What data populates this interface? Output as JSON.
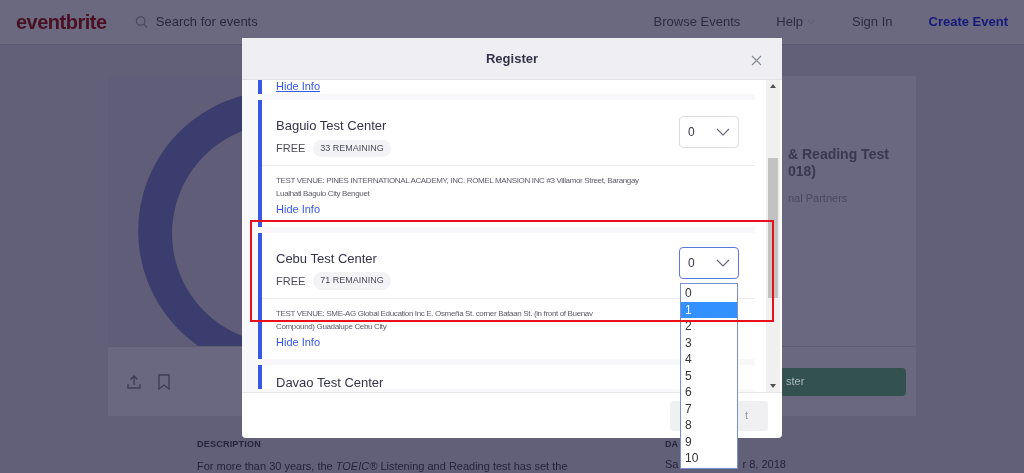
{
  "header": {
    "logo": "eventbrite",
    "search_placeholder": "Search for events",
    "nav": [
      {
        "label": "Browse Events",
        "kind": "link"
      },
      {
        "label": "Help",
        "kind": "menu"
      },
      {
        "label": "Sign In",
        "kind": "link"
      },
      {
        "label": "Create Event",
        "kind": "primary"
      }
    ]
  },
  "event": {
    "title_lines": [
      "& Reading Test",
      "018)"
    ],
    "organizer": "nal Partners",
    "register_button": "ster",
    "description_heading": "DESCRIPTION",
    "description": "For more than 30 years, the *TOEIC®* Listening and Reading test has set the",
    "date_heading": "DA",
    "date_parts": [
      "Sa",
      "r 8, 2018"
    ]
  },
  "modal": {
    "title": "Register",
    "tickets": [
      {
        "kind": "tail",
        "link": "Hide Info"
      },
      {
        "kind": "full",
        "name": "Baguio Test Center",
        "price": "FREE",
        "remaining": "33 REMAINING",
        "quantity": "0",
        "focused": false,
        "venue_lines": [
          "TEST VENUE: PINES INTERNATIONAL ACADEMY, INC. ROMEL MANSION INC #3 Villamor Street, Barangay",
          "Lualhati Baguio City Benguet"
        ],
        "link": "Hide Info"
      },
      {
        "kind": "full",
        "name": "Cebu Test Center",
        "price": "FREE",
        "remaining": "71 REMAINING",
        "quantity": "0",
        "focused": true,
        "venue_lines": [
          "TEST VENUE: SME-AG Global Education Inc E. Osmeña St. corner Bataan St. (in front of Buenav",
          "Compound) Guadalupe Cebu City"
        ],
        "link": "Hide Info"
      },
      {
        "kind": "head",
        "name": "Davao Test Center"
      }
    ],
    "dropdown": {
      "options": [
        {
          "label": "0",
          "selected": false
        },
        {
          "label": "1",
          "selected": true
        },
        {
          "label": "2",
          "selected": false
        },
        {
          "label": "3",
          "selected": false
        },
        {
          "label": "4",
          "selected": false
        },
        {
          "label": "5",
          "selected": false
        },
        {
          "label": "6",
          "selected": false
        },
        {
          "label": "7",
          "selected": false
        },
        {
          "label": "8",
          "selected": false
        },
        {
          "label": "9",
          "selected": false
        },
        {
          "label": "10",
          "selected": false
        }
      ]
    },
    "footer_button": {
      "label": "t",
      "disabled": true
    }
  },
  "annotation": {
    "kind": "rectangle"
  }
}
